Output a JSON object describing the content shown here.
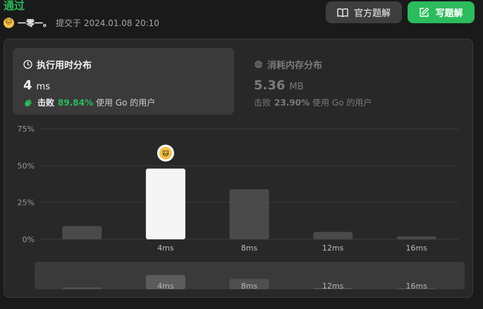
{
  "header": {
    "status": "通过",
    "author_avatar_icon": "cat-avatar-icon",
    "author_name": "一零一。",
    "submitted_text": "提交于 2024.01.08 20:10",
    "official_solution_label": "官方题解",
    "write_solution_label": "写题解"
  },
  "runtime": {
    "title": "执行用时分布",
    "value": "4",
    "unit": "ms",
    "beat_label": "击败",
    "beat_percent": "89.84%",
    "beat_suffix": "使用 Go 的用户"
  },
  "memory": {
    "title": "消耗内存分布",
    "value": "5.36",
    "unit": "MB",
    "beat_label": "击败",
    "beat_percent": "23.90%",
    "beat_suffix": "使用 Go 的用户"
  },
  "colors": {
    "accent_green": "#2cbb5d",
    "highlight_bar": "#f5f5f5",
    "bar": "#4a4a4a",
    "panel": "#282828",
    "card": "#3a3a3a"
  },
  "chart_data": {
    "type": "bar",
    "y_ticks": [
      "75%",
      "50%",
      "25%",
      "0%"
    ],
    "ylim": [
      0,
      75
    ],
    "values": [
      9,
      48,
      34,
      5,
      2
    ],
    "x_labels": [
      "",
      "4ms",
      "8ms",
      "12ms",
      "16ms"
    ],
    "highlight_index": 1,
    "marker_icon": "cat-avatar-icon",
    "grid": true,
    "overview": {
      "values": [
        4,
        30,
        22,
        3,
        2
      ],
      "labels": [
        "",
        "4ms",
        "8ms",
        "12ms",
        "16ms"
      ]
    }
  }
}
